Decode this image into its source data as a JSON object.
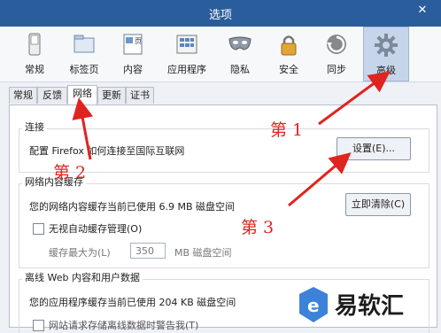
{
  "window": {
    "title": "选项",
    "close_glyph": "✕"
  },
  "toolbar": {
    "items": [
      {
        "label": "常规",
        "icon": "switch-icon"
      },
      {
        "label": "标签页",
        "icon": "folder-tabs-icon"
      },
      {
        "label": "内容",
        "icon": "page-content-icon",
        "icon_text": "页"
      },
      {
        "label": "应用程序",
        "icon": "applications-icon"
      },
      {
        "label": "隐私",
        "icon": "mask-icon"
      },
      {
        "label": "安全",
        "icon": "padlock-icon"
      },
      {
        "label": "同步",
        "icon": "sync-icon"
      },
      {
        "label": "高级",
        "icon": "gear-icon",
        "selected": true
      }
    ]
  },
  "tabs": [
    {
      "label": "常规"
    },
    {
      "label": "反馈"
    },
    {
      "label": "网络",
      "active": true
    },
    {
      "label": "更新"
    },
    {
      "label": "证书"
    }
  ],
  "connection": {
    "title": "连接",
    "description": "配置 Firefox 如何连接至国际互联网",
    "settings_button": "设置(E)..."
  },
  "cache": {
    "title": "网络内容缓存",
    "usage_text": "您的网络内容缓存当前已使用 6.9 MB 磁盘空间",
    "clear_button": "立即清除(C)",
    "override_label": "无视自动缓存管理(O)",
    "override_checked": false,
    "limit_label": "缓存最大为(L)",
    "limit_value": "350",
    "limit_unit": "MB 磁盘空间"
  },
  "offline": {
    "title": "离线 Web 内容和用户数据",
    "usage_text": "您的应用程序缓存当前已使用 204 KB 磁盘空间",
    "next_line_partial": "网站请求存储离线数据时警告我(T)"
  },
  "annotations": {
    "step1": "第 1",
    "step2": "第 2",
    "step3": "第 3",
    "color": "#e0241f"
  },
  "watermark": {
    "text": "易软汇"
  }
}
